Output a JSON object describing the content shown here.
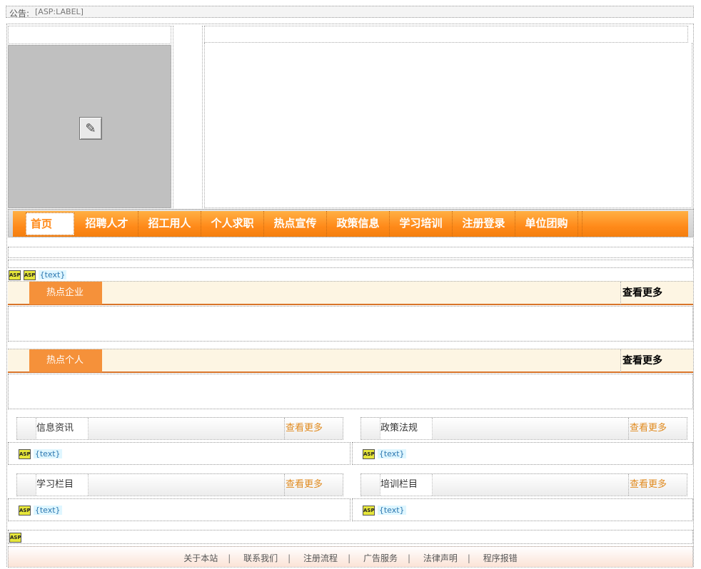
{
  "notice": {
    "label": "公告:",
    "value": "[ASP:LABEL]"
  },
  "asp_badge": "ASP",
  "text_tag": "{text}",
  "nav": {
    "items": [
      "首页",
      "招聘人才",
      "招工用人",
      "个人求职",
      "热点宣传",
      "政策信息",
      "学习培训",
      "注册登录",
      "单位团购"
    ]
  },
  "sections": [
    {
      "title": "热点企业",
      "more": "查看更多"
    },
    {
      "title": "热点个人",
      "more": "查看更多"
    }
  ],
  "panels": [
    {
      "title": "信息资讯",
      "more": "查看更多"
    },
    {
      "title": "政策法规",
      "more": "查看更多"
    },
    {
      "title": "学习栏目",
      "more": "查看更多"
    },
    {
      "title": "培训栏目",
      "more": "查看更多"
    }
  ],
  "footer": {
    "links": [
      "关于本站",
      "联系我们",
      "注册流程",
      "广告服务",
      "法律声明",
      "程序报错"
    ],
    "separator": "|"
  },
  "colors": {
    "accent": "#ff8a1a",
    "section_bg": "#fdf5e3",
    "section_tab": "#f5913a",
    "more_link": "#e08a1e"
  },
  "icons": [
    "flash-placeholder-icon",
    "asp-control-icon"
  ]
}
